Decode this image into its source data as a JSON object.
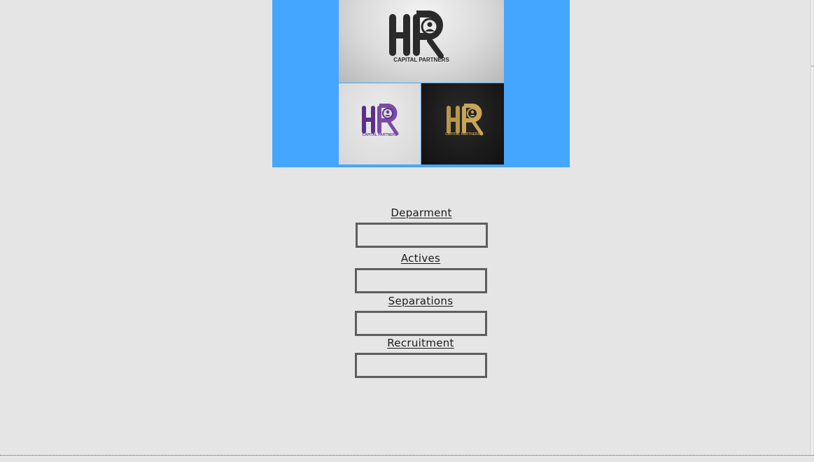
{
  "brand": {
    "logo_text": "HR",
    "tagline": "CAPITAL PARTNERS",
    "banner_color": "#45a6ff",
    "variants": [
      "black-on-silver",
      "purple-on-white",
      "gold-on-black"
    ]
  },
  "form": {
    "fields": [
      {
        "label": "Deparment",
        "value": "",
        "placeholder": ""
      },
      {
        "label": "Actives",
        "value": "",
        "placeholder": ""
      },
      {
        "label": "Separations",
        "value": "",
        "placeholder": ""
      },
      {
        "label": "Recruitment",
        "value": "",
        "placeholder": ""
      }
    ]
  }
}
